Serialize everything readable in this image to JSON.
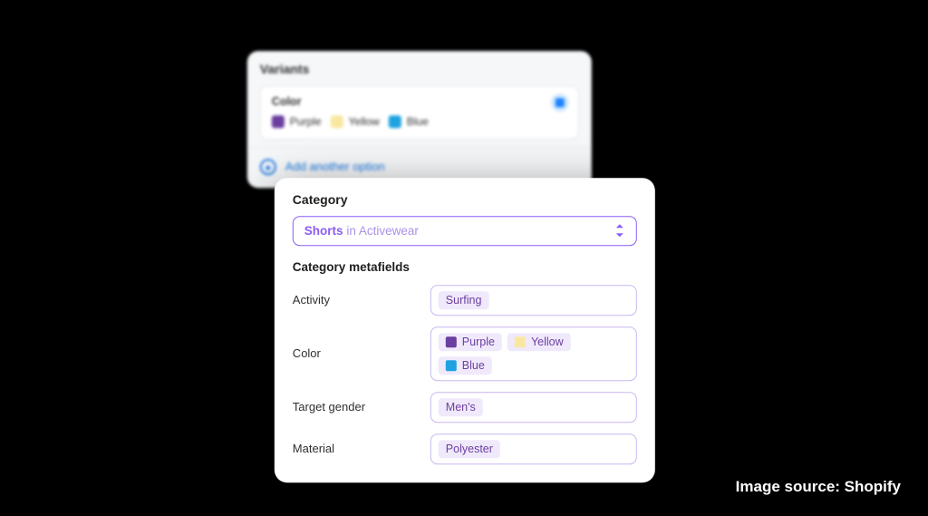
{
  "variants_card": {
    "title": "Variants",
    "option_name": "Color",
    "colors": [
      {
        "name": "Purple",
        "class": "purple"
      },
      {
        "name": "Yellow",
        "class": "yellow"
      },
      {
        "name": "Blue",
        "class": "blue"
      }
    ],
    "add_option_label": "Add another option"
  },
  "category_card": {
    "title": "Category",
    "selected_primary": "Shorts",
    "selected_secondary": " in Activewear",
    "metafields_title": "Category metafields",
    "fields": {
      "activity": {
        "label": "Activity",
        "value": "Surfing"
      },
      "color": {
        "label": "Color",
        "values": [
          {
            "name": "Purple",
            "class": "purple"
          },
          {
            "name": "Yellow",
            "class": "yellow"
          },
          {
            "name": "Blue",
            "class": "blue"
          }
        ]
      },
      "target_gender": {
        "label": "Target gender",
        "value": "Men's"
      },
      "material": {
        "label": "Material",
        "value": "Polyester"
      }
    }
  },
  "credit": "Image source: Shopify"
}
